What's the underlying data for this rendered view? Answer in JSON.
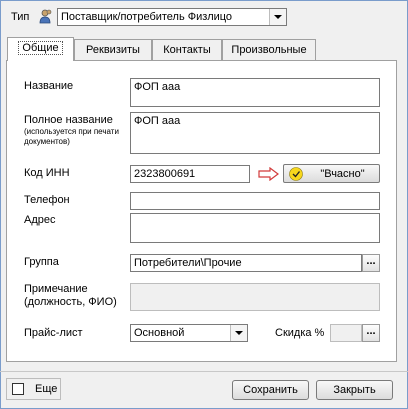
{
  "header": {
    "type_label": "Тип",
    "type_value": "Поставщик/потребитель Физлицо"
  },
  "tabs": [
    {
      "label": "Общие"
    },
    {
      "label": "Реквизиты"
    },
    {
      "label": "Контакты"
    },
    {
      "label": "Произвольные"
    }
  ],
  "form": {
    "name_label": "Название",
    "name_value": "ФОП ааа",
    "fullname_label": "Полное название",
    "fullname_hint": "(используется при печати документов)",
    "fullname_value": "ФОП ааа",
    "inn_label": "Код ИНН",
    "inn_value": "2323800691",
    "manual_button": "\"Вчасно\"",
    "phone_label": "Телефон",
    "phone_value": "",
    "address_label": "Адрес",
    "address_value": "",
    "group_label": "Группа",
    "group_value": "Потребители\\Прочие",
    "note_label": "Примечание (должность, ФИО)",
    "note_value": "",
    "pricelist_label": "Прайс-лист",
    "pricelist_value": "Основной",
    "discount_label": "Скидка %",
    "discount_value": "",
    "dots": "..."
  },
  "footer": {
    "more_label": "Еще",
    "more_checked": false,
    "save_label": "Сохранить",
    "close_label": "Закрыть"
  }
}
